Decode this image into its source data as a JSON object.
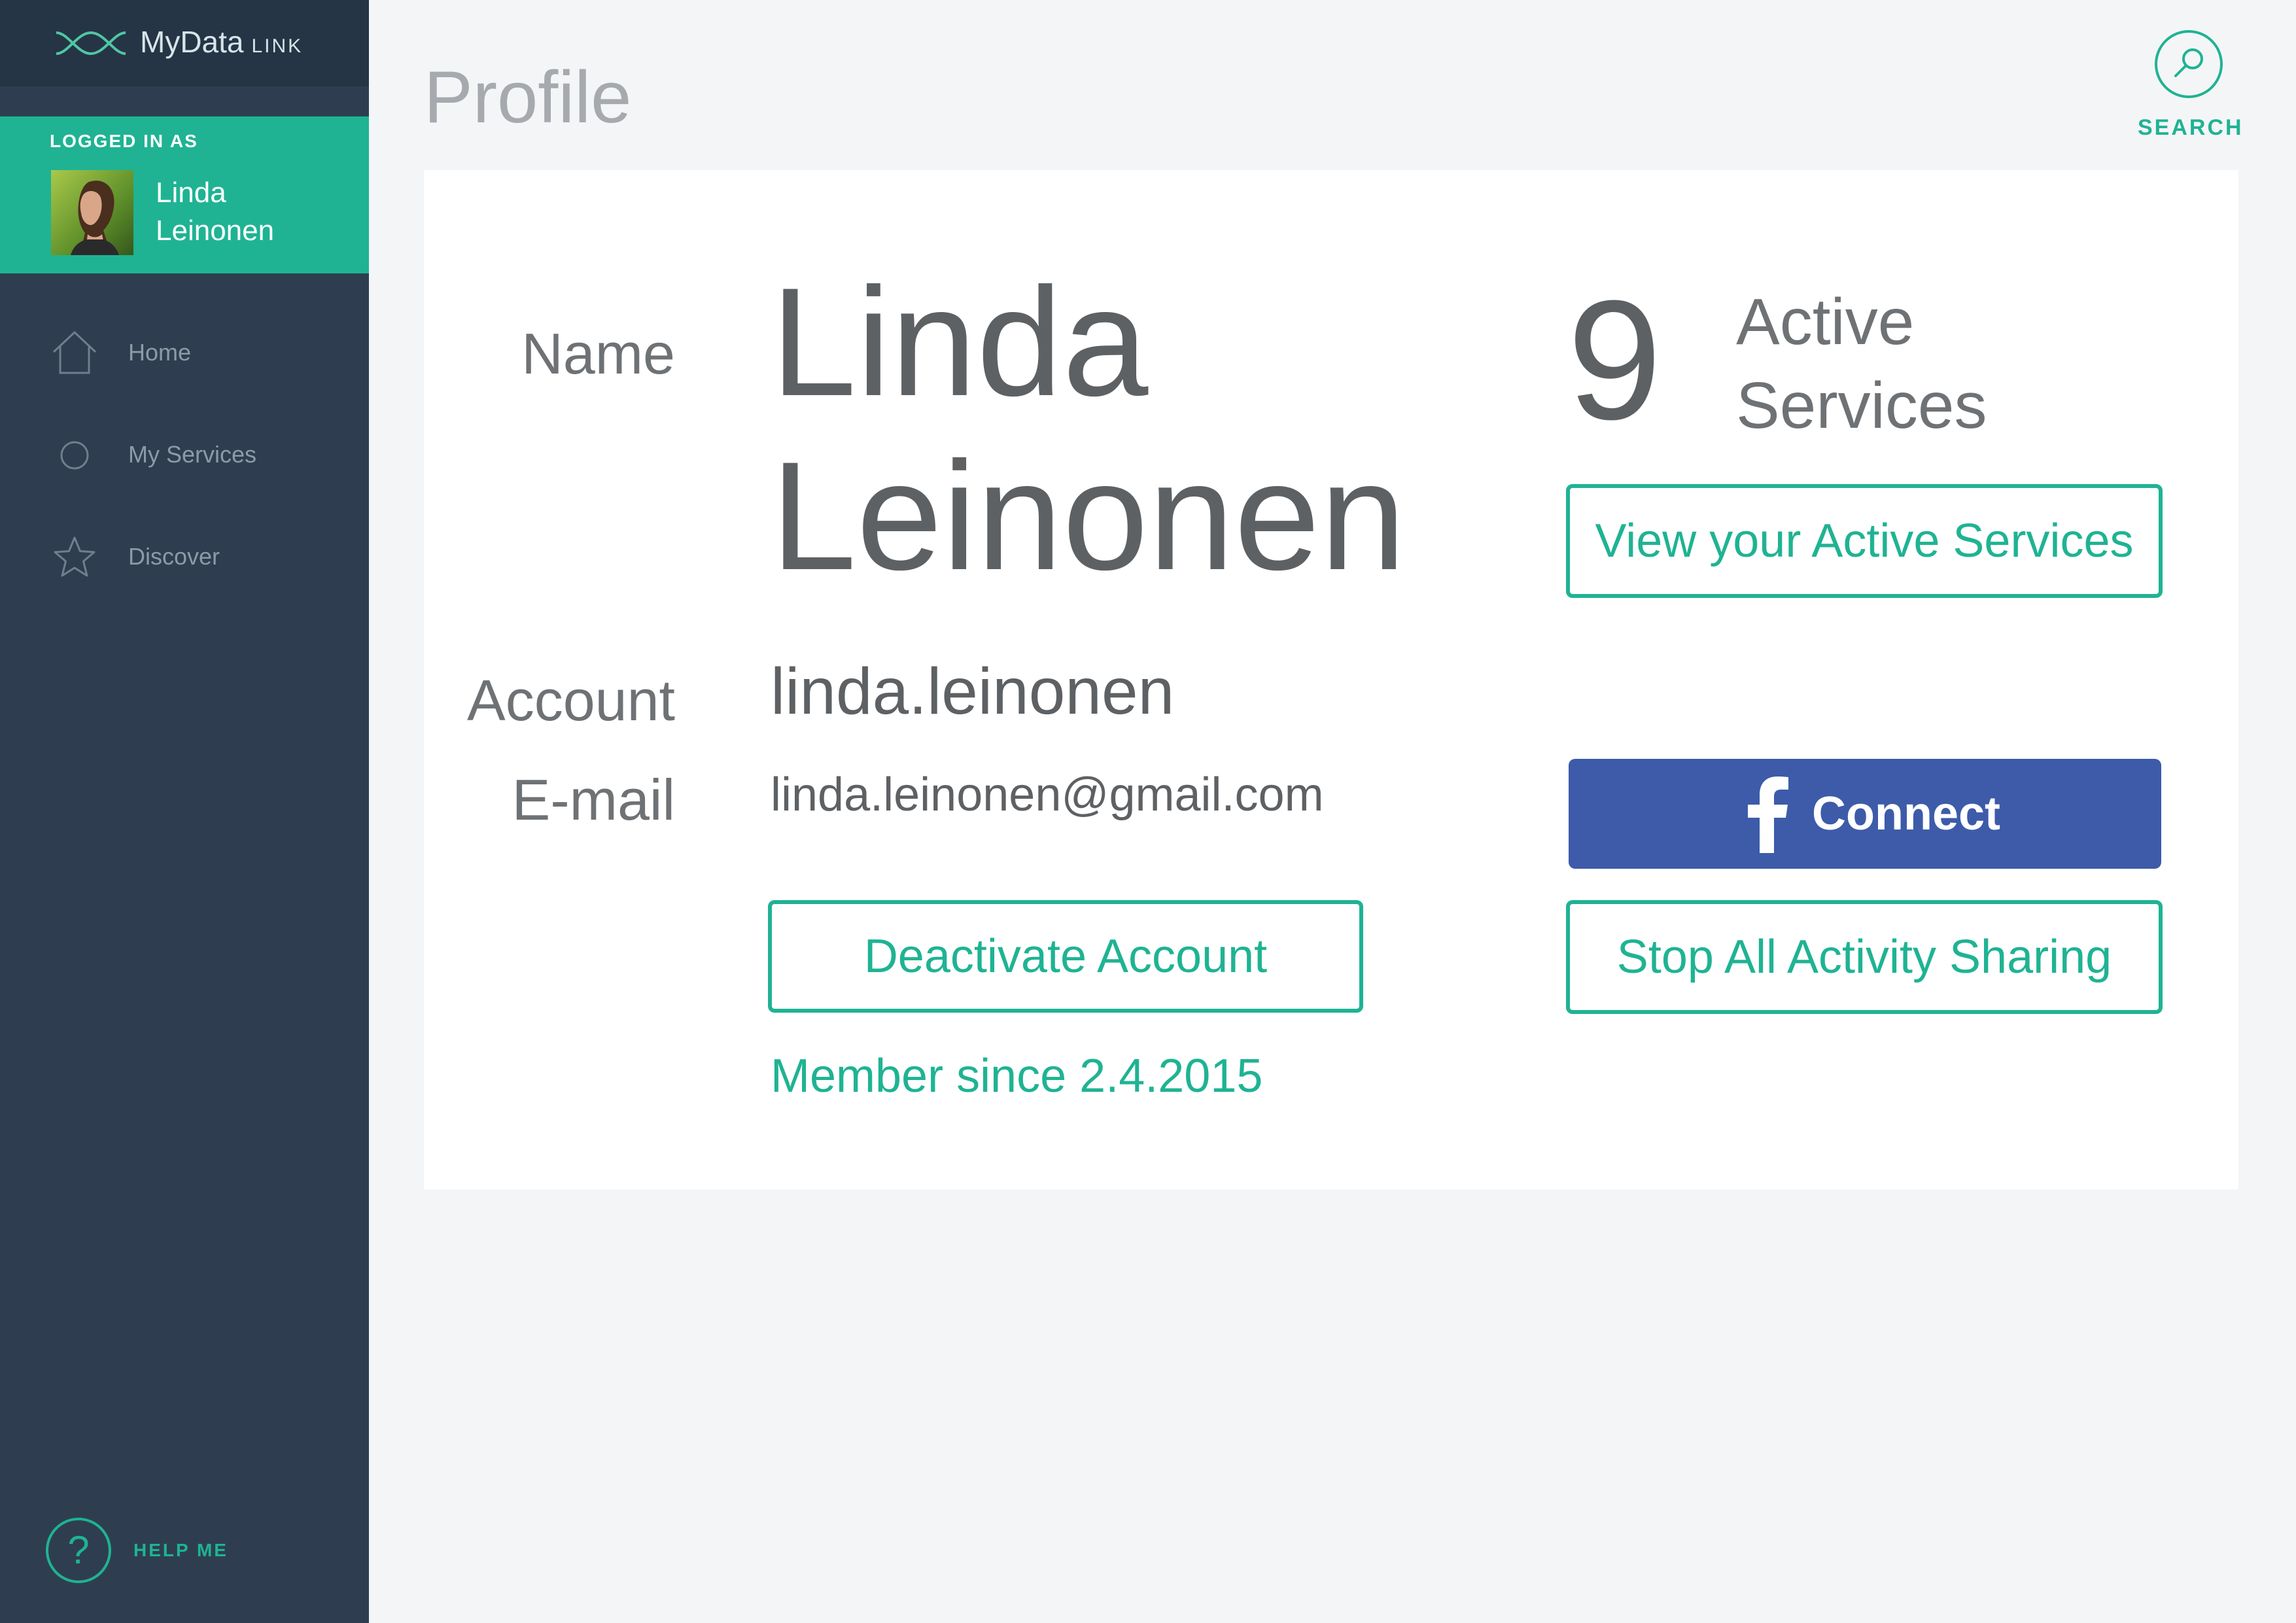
{
  "app": {
    "name": "MyData",
    "name_suffix": "LINK"
  },
  "sidebar": {
    "logged_in_label": "LOGGED IN AS",
    "user": {
      "first_name": "Linda",
      "last_name": "Leinonen"
    },
    "items": [
      {
        "label": "Home",
        "icon": "home-icon"
      },
      {
        "label": "My Services",
        "icon": "circle-icon"
      },
      {
        "label": "Discover",
        "icon": "star-icon"
      }
    ],
    "help_label": "HELP ME"
  },
  "header": {
    "title": "Profile",
    "search_label": "SEARCH"
  },
  "profile": {
    "name_label": "Name",
    "first_name": "Linda",
    "last_name": "Leinonen",
    "account_label": "Account",
    "account": "linda.leinonen",
    "email_label": "E-mail",
    "email": "linda.leinonen@gmail.com",
    "deactivate_label": "Deactivate Account",
    "member_since": "Member since 2.4.2015"
  },
  "services": {
    "count": "9",
    "label_line1": "Active",
    "label_line2": "Services",
    "view_label": "View your Active Services",
    "facebook_label": "Connect",
    "stop_sharing_label": "Stop All Activity Sharing"
  },
  "colors": {
    "accent": "#1fb393",
    "sidebar": "#2e3e50",
    "facebook": "#3d5ba9"
  }
}
